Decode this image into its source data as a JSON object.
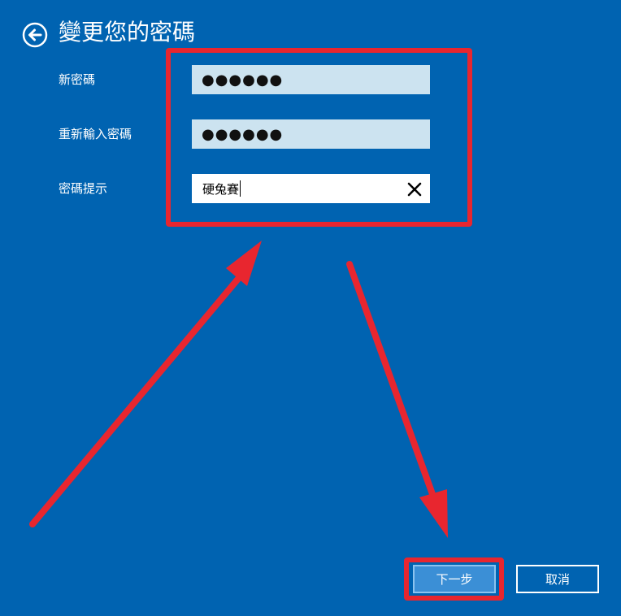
{
  "header": {
    "title": "變更您的密碼"
  },
  "form": {
    "new_password": {
      "label": "新密碼",
      "value_masked": "●●●●●●"
    },
    "confirm_password": {
      "label": "重新輸入密碼",
      "value_masked": "●●●●●●"
    },
    "password_hint": {
      "label": "密碼提示",
      "value": "硬兔賽"
    }
  },
  "footer": {
    "next_label": "下一步",
    "cancel_label": "取消"
  },
  "colors": {
    "background": "#0063b1",
    "annotation": "#e8262f",
    "password_field": "#cce3f0",
    "next_button": "#3b8fd6"
  },
  "icons": {
    "back": "back-arrow-circle-icon",
    "clear": "close-icon"
  }
}
